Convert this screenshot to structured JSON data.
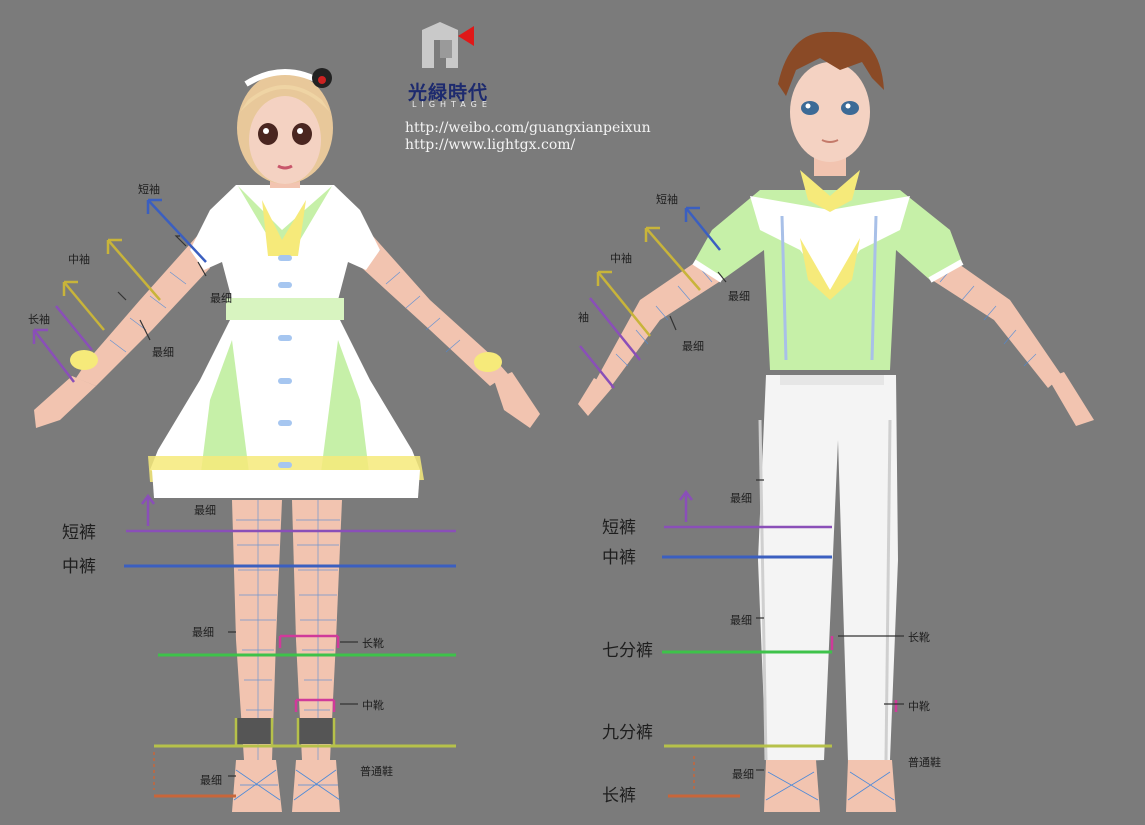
{
  "branding": {
    "name": "光緑時代",
    "subtitle": "LIGHTAGE",
    "links": [
      "http://weibo.com/guangxianpeixun",
      "http://www.lightgx.com/"
    ]
  },
  "girl_labels": {
    "sleeve_short": "短袖",
    "sleeve_mid": "中袖",
    "sleeve_long": "长袖",
    "thinnest_1": "最细",
    "thinnest_2": "最细",
    "thinnest_3": "最细",
    "thinnest_4": "最细",
    "thinnest_5": "最细",
    "shorts": "短裤",
    "mid_pants": "中裤",
    "boot_long": "长靴",
    "boot_mid": "中靴",
    "shoe_normal": "普通鞋"
  },
  "boy_labels": {
    "sleeve_short": "短袖",
    "sleeve_mid": "中袖",
    "sleeve_long": "袖",
    "thinnest_1": "最细",
    "thinnest_2": "最细",
    "thinnest_3": "最细",
    "thinnest_4": "最细",
    "thinnest_5": "最细",
    "shorts": "短裤",
    "mid_pants": "中裤",
    "seven_pants": "七分裤",
    "nine_pants": "九分裤",
    "long_pants": "长裤",
    "boot_long": "长靴",
    "boot_mid": "中靴",
    "shoe_normal": "普通鞋"
  },
  "colors": {
    "background": "#7b7b7b",
    "purple": "#8a4fb8",
    "blue": "#3b5fc0",
    "yellow": "#c8b43a",
    "green": "#3ec24a",
    "olive": "#b6c14a",
    "orange": "#c8663a",
    "magenta": "#d03a9a",
    "shirt_green": "#c6f0a8",
    "skin": "#f2c4b0"
  }
}
